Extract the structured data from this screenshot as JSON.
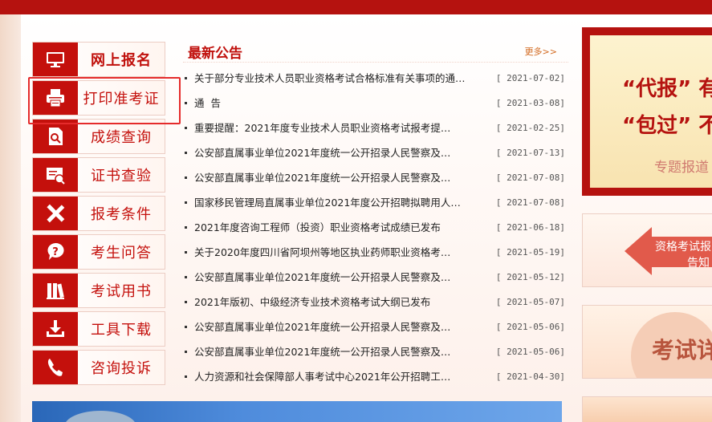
{
  "menu": {
    "items": [
      {
        "label": "网上报名",
        "icon": "monitor-icon"
      },
      {
        "label": "打印准考证",
        "icon": "printer-icon"
      },
      {
        "label": "成绩查询",
        "icon": "document-search-icon"
      },
      {
        "label": "证书查验",
        "icon": "certificate-search-icon"
      },
      {
        "label": "报考条件",
        "icon": "ruler-pencil-icon"
      },
      {
        "label": "考生问答",
        "icon": "question-icon"
      },
      {
        "label": "考试用书",
        "icon": "books-icon"
      },
      {
        "label": "工具下载",
        "icon": "download-icon"
      },
      {
        "label": "咨询投诉",
        "icon": "phone-icon"
      }
    ]
  },
  "news": {
    "title": "最新公告",
    "more": "更多>>",
    "items": [
      {
        "text": "关于部分专业技术人员职业资格考试合格标准有关事项的通…",
        "date": "[ 2021-07-02]"
      },
      {
        "text": "通  告",
        "date": "[ 2021-03-08]"
      },
      {
        "text": "重要提醒：2021年度专业技术人员职业资格考试报考提…",
        "date": "[ 2021-02-25]"
      },
      {
        "text": "公安部直属事业单位2021年度统一公开招录人民警察及…",
        "date": "[ 2021-07-13]"
      },
      {
        "text": "公安部直属事业单位2021年度统一公开招录人民警察及…",
        "date": "[ 2021-07-08]"
      },
      {
        "text": "国家移民管理局直属事业单位2021年度公开招聘拟聘用人…",
        "date": "[ 2021-07-08]"
      },
      {
        "text": "2021年度咨询工程师（投资）职业资格考试成绩已发布",
        "date": "[ 2021-06-18]"
      },
      {
        "text": "关于2020年度四川省阿坝州等地区执业药师职业资格考…",
        "date": "[ 2021-05-19]"
      },
      {
        "text": "公安部直属事业单位2021年度统一公开招录人民警察及…",
        "date": "[ 2021-05-12]"
      },
      {
        "text": "2021年版初、中级经济专业技术资格考试大纲已发布",
        "date": "[ 2021-05-07]"
      },
      {
        "text": "公安部直属事业单位2021年度统一公开招录人民警察及…",
        "date": "[ 2021-05-06]"
      },
      {
        "text": "公安部直属事业单位2021年度统一公开招录人民警察及…",
        "date": "[ 2021-05-06]"
      },
      {
        "text": "人力资源和社会保障部人事考试中心2021年公开招聘工…",
        "date": "[ 2021-04-30]"
      }
    ]
  },
  "banners": {
    "b1_line1": "“代报” 有",
    "b1_line2": "“包过” 不",
    "b1_line3": "专题报道",
    "b2_line1": "资格考试报",
    "b2_line2": "告知",
    "b3_text": "考试详"
  },
  "colors": {
    "brand_red": "#c4100c",
    "highlight": "#e52b2b"
  }
}
